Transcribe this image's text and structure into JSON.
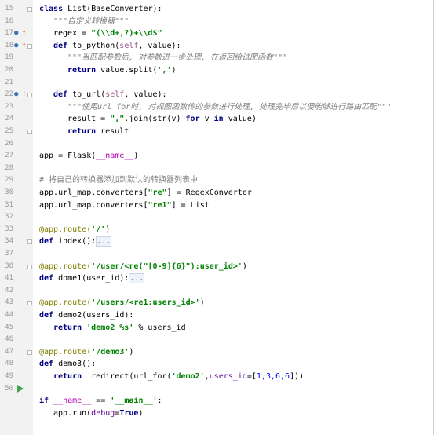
{
  "gutter": {
    "line_numbers": [
      "15",
      "16",
      "17",
      "18",
      "19",
      "20",
      "21",
      "22",
      "23",
      "24",
      "25",
      "26",
      "27",
      "28",
      "29",
      "30",
      "31",
      "32",
      "33",
      "34",
      "37",
      "38",
      "41",
      "42",
      "43",
      "44",
      "45",
      "46",
      "47",
      "48",
      "49",
      "50"
    ]
  },
  "code": {
    "l15_kw": "class",
    "l15_rest": " List(BaseConverter):",
    "l16": "\"\"\"自定义转换器\"\"\"",
    "l17_a": "regex = ",
    "l17_str": "\"(\\\\d+,?)+\\\\d$\"",
    "l18_kw": "def",
    "l18_name": " to_python(",
    "l18_self": "self",
    "l18_rest": ", value):",
    "l19": "\"\"\"当匹配参数后, 对参数进一步处理, 在返回给试图函数\"\"\"",
    "l20_kw": "return",
    "l20_a": " value.split(",
    "l20_str": "','",
    "l20_b": ")",
    "l22_kw": "def",
    "l22_name": " to_url(",
    "l22_self": "self",
    "l22_rest": ", value):",
    "l23": "\"\"\"使用url_for时, 对视图函数传的参数进行处理, 处理完毕后以便能够进行路由匹配\"\"\"",
    "l24_a": "result = ",
    "l24_str": "\",\"",
    "l24_b": ".join(str(v) ",
    "l24_for": "for",
    "l24_c": " v ",
    "l24_in": "in",
    "l24_d": " value)",
    "l25_kw": "return",
    "l25_rest": " result",
    "l27_a": "app = Flask(",
    "l27_dunder": "__name__",
    "l27_b": ")",
    "l29": "# 将自己的转换器添加到默认的转换器列表中",
    "l30_a": "app.url_map.converters[",
    "l30_str": "\"re\"",
    "l30_b": "] = RegexConverter",
    "l31_a": "app.url_map.converters[",
    "l31_str": "\"re1\"",
    "l31_b": "] = List",
    "l33_dec": "@app.route(",
    "l33_str": "'/'",
    "l33_b": ")",
    "l34_kw": "def",
    "l34_a": " index():",
    "l34_fold": "...",
    "l37_dec": "@app.route(",
    "l37_str": "'/user/<re(\"[0-9]{6}\"):user_id>'",
    "l37_b": ")",
    "l38_kw": "def",
    "l38_a": " dome1(user_id):",
    "l38_fold": "...",
    "l41_dec": "@app.route(",
    "l41_str": "'/users/<re1:users_id>'",
    "l41_b": ")",
    "l42_kw": "def",
    "l42_a": " demo2(users_id):",
    "l43_kw": "return",
    "l43_str": " 'demo2 %s'",
    "l43_b": " % users_id",
    "l45_dec": "@app.route(",
    "l45_str": "'/demo3'",
    "l45_b": ")",
    "l46_kw": "def",
    "l46_a": " demo3():",
    "l47_kw": "return",
    "l47_a": "  redirect(url_for(",
    "l47_str": "'demo2'",
    "l47_b": ",",
    "l47_kwarg": "users_id",
    "l47_c": "=[",
    "l47_nums": "1,3,6,6",
    "l47_d": "]))",
    "l49_kw": "if",
    "l49_dunder": " __name__",
    "l49_a": " == ",
    "l49_str": "'__main__'",
    "l49_b": ":",
    "l50_a": "app.run(",
    "l50_kwarg": "debug",
    "l50_b": "=",
    "l50_kw": "True",
    "l50_c": ")"
  }
}
